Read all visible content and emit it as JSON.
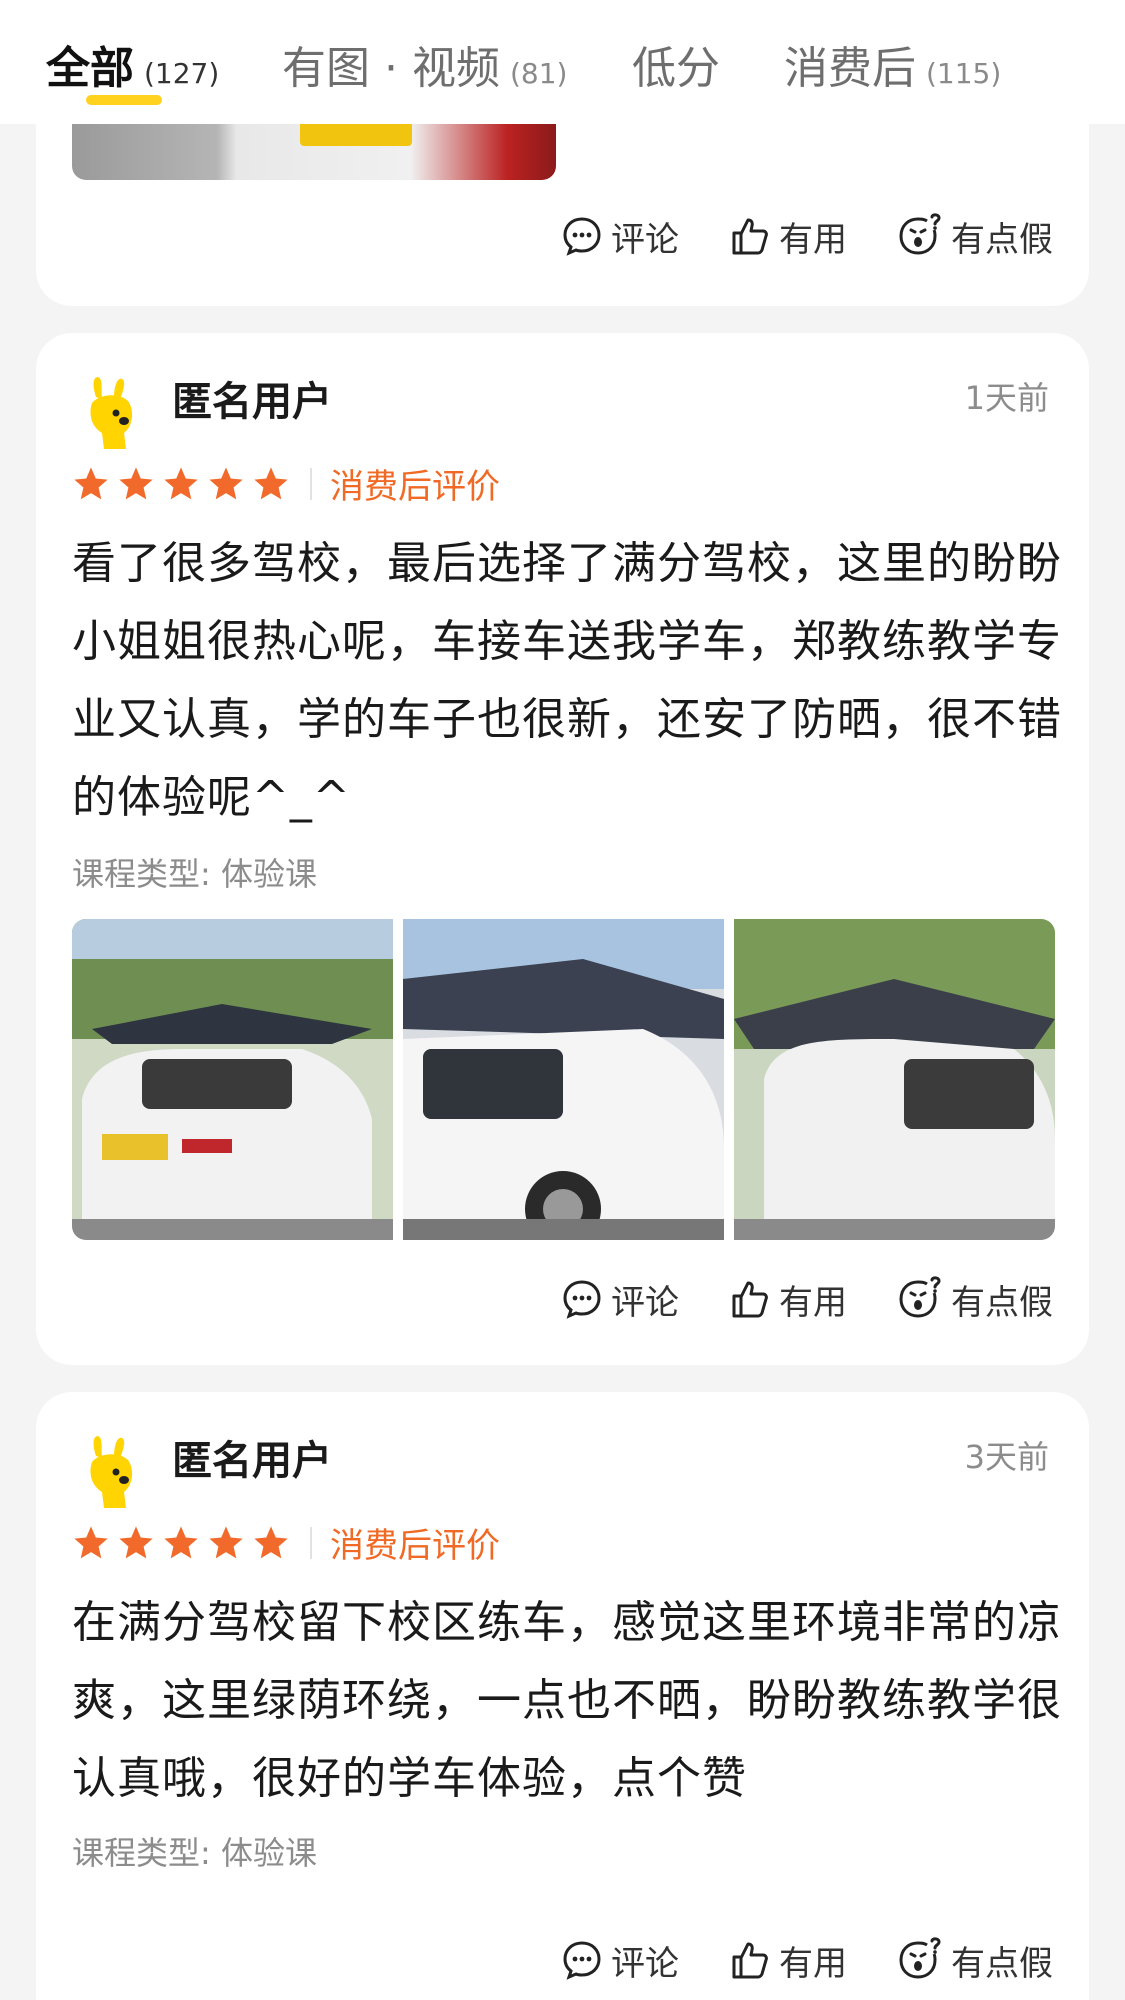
{
  "tabs": [
    {
      "label": "全部",
      "count": "(127)"
    },
    {
      "label": "有图 · 视频",
      "count": "(81)"
    },
    {
      "label": "低分",
      "count": ""
    },
    {
      "label": "消费后",
      "count": "(115)"
    }
  ],
  "actions": {
    "comment": "评论",
    "useful": "有用",
    "fake": "有点假"
  },
  "reviews": [
    {
      "username": "匿名用户",
      "time": "1天前",
      "rating": 5,
      "badge": "消费后评价",
      "text": "看了很多驾校，最后选择了满分驾校，这里的盼盼小姐姐很热心呢，车接车送我学车，郑教练教学专业又认真，学的车子也很新，还安了防晒，很不错的体验呢^_^",
      "course": "课程类型: 体验课"
    },
    {
      "username": "匿名用户",
      "time": "3天前",
      "rating": 5,
      "badge": "消费后评价",
      "text": "在满分驾校留下校区练车，感觉这里环境非常的凉爽，这里绿荫环绕，一点也不晒，盼盼教练教学很认真哦，很好的学车体验，点个赞",
      "course": "课程类型: 体验课"
    }
  ],
  "colors": {
    "accent_yellow": "#ffd21f",
    "star_orange": "#f26a2b",
    "badge_orange": "#f06a25"
  }
}
